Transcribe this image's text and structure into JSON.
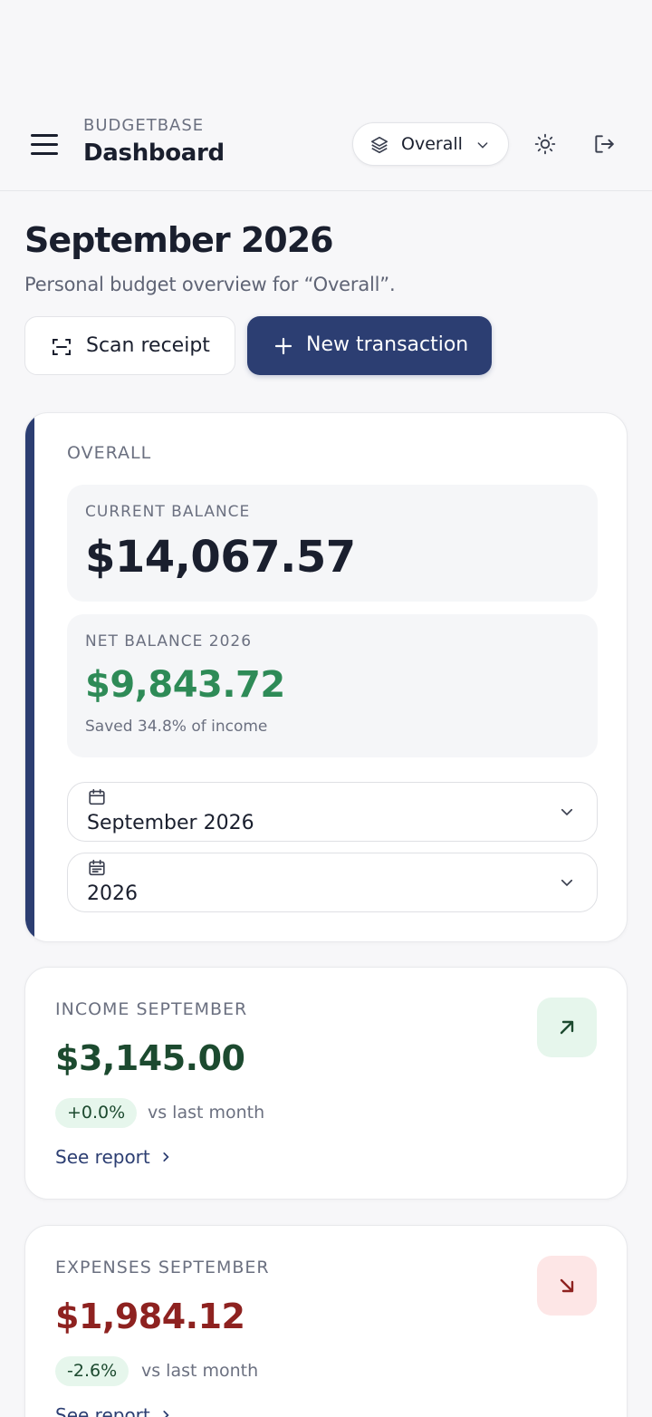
{
  "header": {
    "brand": "BUDGETBASE",
    "title": "Dashboard",
    "scope_label": "Overall"
  },
  "page": {
    "title": "September 2026",
    "subtitle": "Personal budget overview for “Overall”."
  },
  "actions": {
    "scan_label": "Scan receipt",
    "new_label": "New transaction"
  },
  "overall": {
    "section_label": "OVERALL",
    "current_balance_label": "CURRENT BALANCE",
    "current_balance": "$14,067.57",
    "net_balance_label": "NET BALANCE 2026",
    "net_balance": "$9,843.72",
    "net_note": "Saved 34.8% of income",
    "month_picker": "September 2026",
    "year_picker": "2026"
  },
  "income": {
    "label": "INCOME SEPTEMBER",
    "value": "$3,145.00",
    "change": "+0.0%",
    "compare": "vs last month",
    "link": "See report"
  },
  "expenses": {
    "label": "EXPENSES SEPTEMBER",
    "value": "$1,984.12",
    "change": "-2.6%",
    "compare": "vs last month",
    "link": "See report"
  },
  "colors": {
    "primary": "#2c3e72",
    "positive": "#2e8b57",
    "income_value": "#1c4a2f",
    "expense_value": "#8e2220",
    "background": "#f7f7f9"
  },
  "icons": {
    "menu": "menu-icon",
    "scope": "layers-icon",
    "theme": "sun-icon",
    "logout": "logout-icon",
    "scan": "scan-icon",
    "new": "plus-icon",
    "month": "calendar-icon",
    "year": "calendar-list-icon",
    "income": "arrow-up-right-icon",
    "expenses": "arrow-down-right-icon"
  }
}
